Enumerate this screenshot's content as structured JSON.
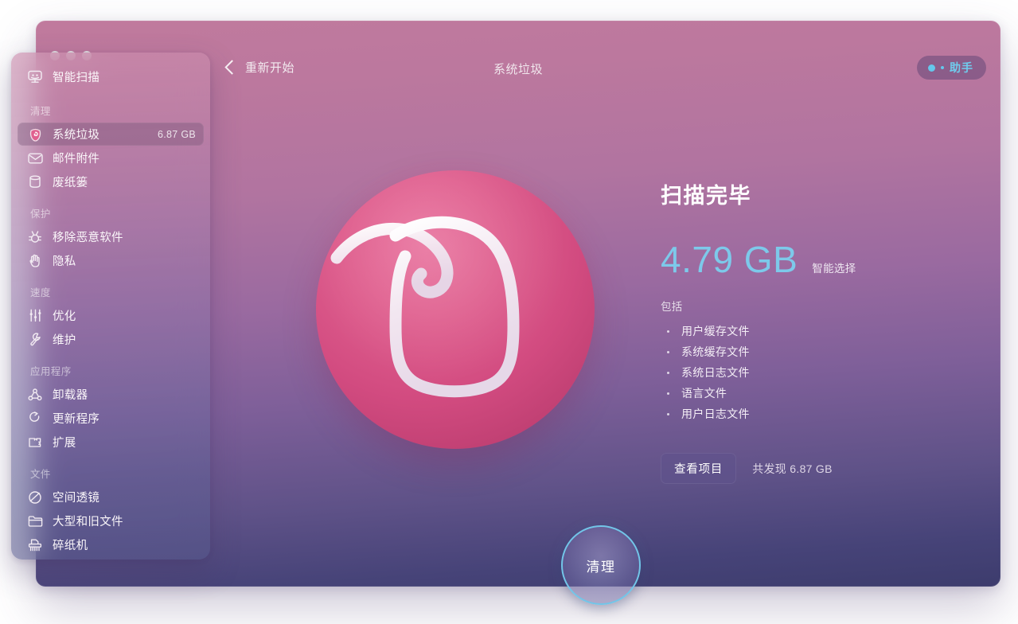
{
  "window": {
    "traffic_lights": [
      "close",
      "minimize",
      "zoom"
    ],
    "back_label": "重新开始",
    "title": "系统垃圾",
    "assistant_label": "助手"
  },
  "sidebar": {
    "top_item": {
      "label": "智能扫描",
      "icon": "smart-scan-icon"
    },
    "sections": [
      {
        "title": "清理",
        "items": [
          {
            "label": "系统垃圾",
            "badge": "6.87 GB",
            "icon": "system-junk-icon",
            "selected": true
          },
          {
            "label": "邮件附件",
            "badge": "",
            "icon": "mail-attachments-icon",
            "selected": false
          },
          {
            "label": "废纸篓",
            "badge": "",
            "icon": "trash-bins-icon",
            "selected": false
          }
        ]
      },
      {
        "title": "保护",
        "items": [
          {
            "label": "移除恶意软件",
            "badge": "",
            "icon": "malware-removal-icon",
            "selected": false
          },
          {
            "label": "隐私",
            "badge": "",
            "icon": "privacy-hand-icon",
            "selected": false
          }
        ]
      },
      {
        "title": "速度",
        "items": [
          {
            "label": "优化",
            "badge": "",
            "icon": "optimization-sliders-icon",
            "selected": false
          },
          {
            "label": "维护",
            "badge": "",
            "icon": "maintenance-wrench-icon",
            "selected": false
          }
        ]
      },
      {
        "title": "应用程序",
        "items": [
          {
            "label": "卸载器",
            "badge": "",
            "icon": "uninstaller-icon",
            "selected": false
          },
          {
            "label": "更新程序",
            "badge": "",
            "icon": "updater-icon",
            "selected": false
          },
          {
            "label": "扩展",
            "badge": "",
            "icon": "extensions-icon",
            "selected": false
          }
        ]
      },
      {
        "title": "文件",
        "items": [
          {
            "label": "空间透镜",
            "badge": "",
            "icon": "space-lens-icon",
            "selected": false
          },
          {
            "label": "大型和旧文件",
            "badge": "",
            "icon": "large-old-files-icon",
            "selected": false
          },
          {
            "label": "碎纸机",
            "badge": "",
            "icon": "shredder-icon",
            "selected": false
          }
        ]
      }
    ]
  },
  "main": {
    "logo_icon": "cleanmymac-logo",
    "scan_status": "扫描完毕",
    "selected_size": "4.79 GB",
    "selection_mode": "智能选择",
    "includes_label": "包括",
    "includes": [
      "用户缓存文件",
      "系统缓存文件",
      "系统日志文件",
      "语言文件",
      "用户日志文件"
    ],
    "view_items_button": "查看项目",
    "found_total": "共发现 6.87 GB",
    "clean_button": "清理"
  },
  "colors": {
    "accent_cyan": "#7dc9ea",
    "logo_pink": "#d24b80",
    "window_top": "#c07a9d",
    "window_bottom": "#3d3c6d"
  }
}
